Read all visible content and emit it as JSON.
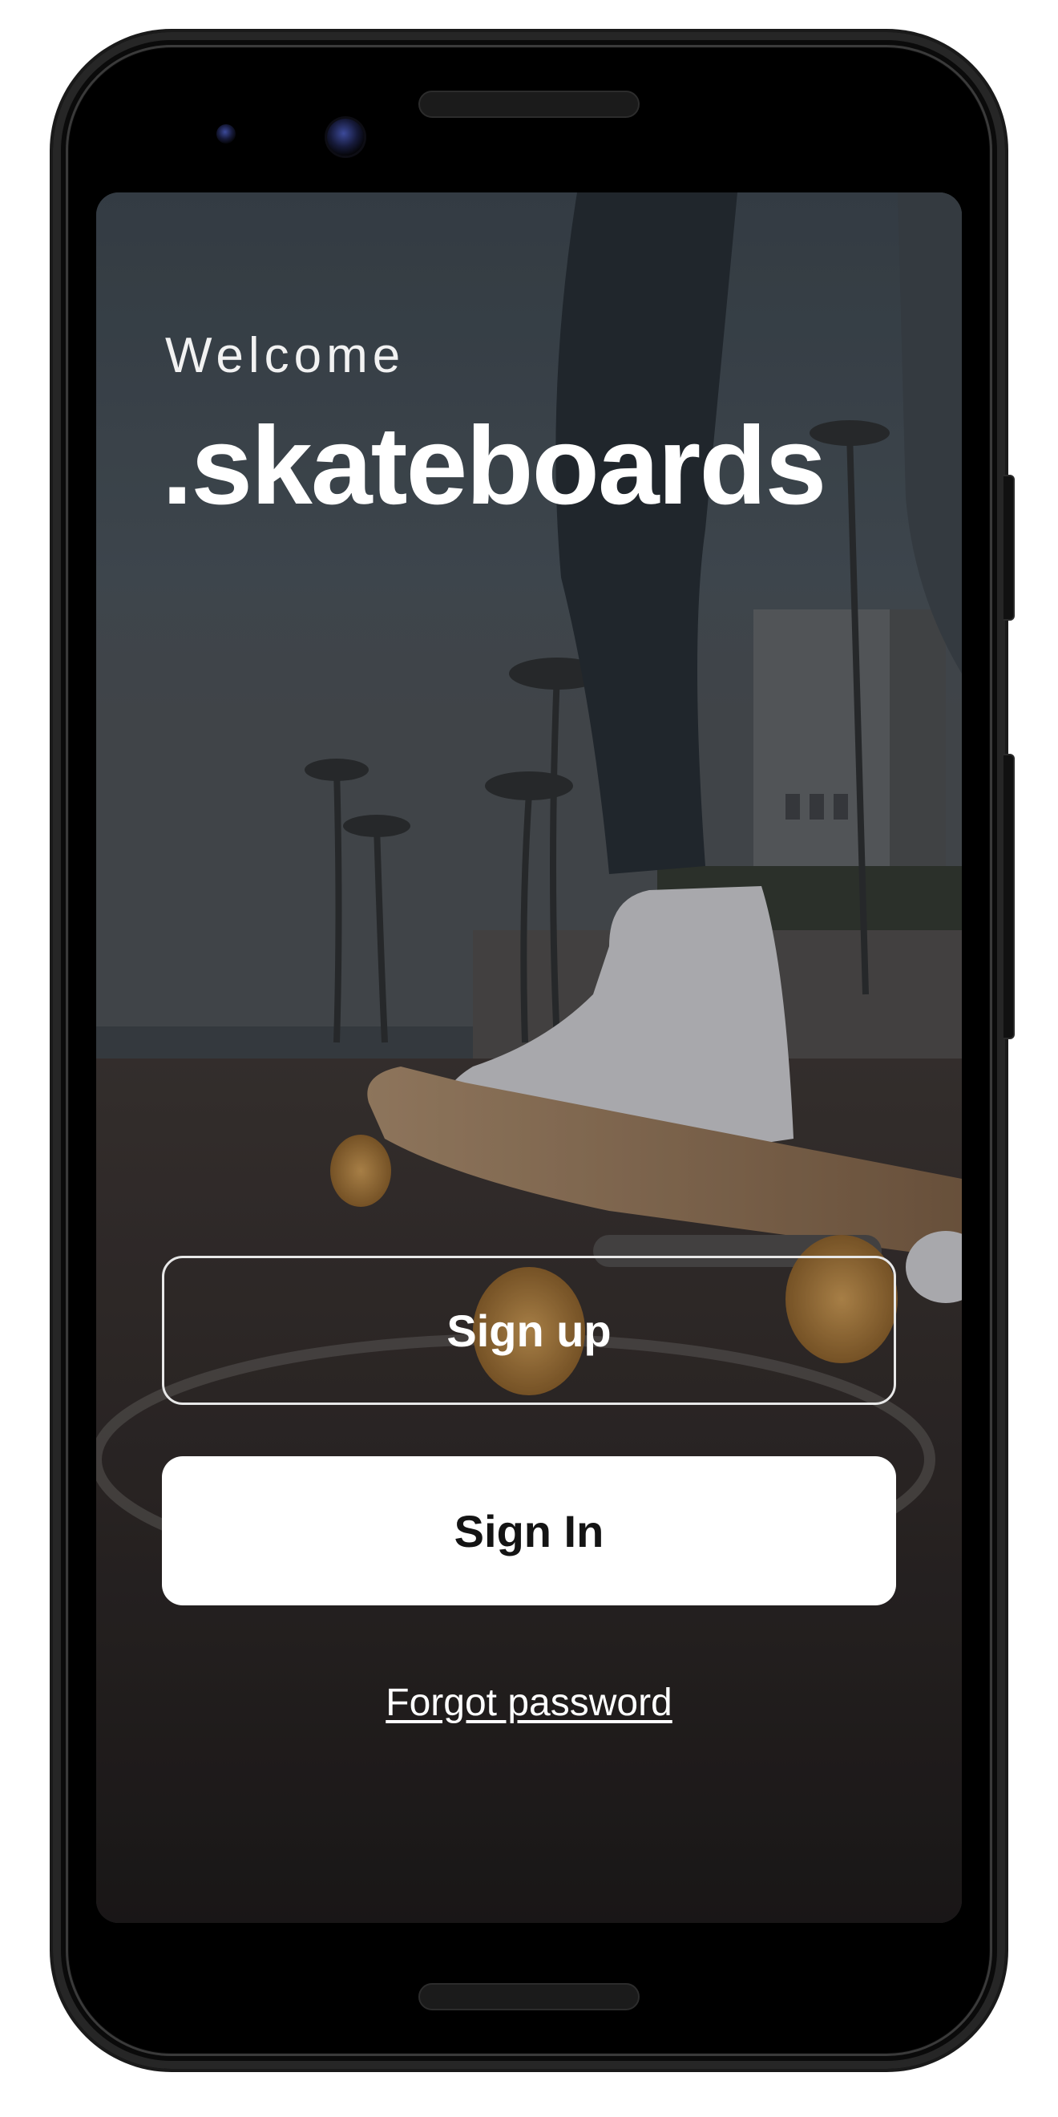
{
  "device": {
    "frame_color": "#000000"
  },
  "welcome": {
    "title": "Welcome",
    "brand": ".skateboards"
  },
  "actions": {
    "signup_label": "Sign up",
    "signin_label": "Sign In",
    "forgot_label": "Forgot password"
  },
  "colors": {
    "text": "#ffffff",
    "primary_button_bg": "#ffffff",
    "primary_button_text": "#141414"
  }
}
